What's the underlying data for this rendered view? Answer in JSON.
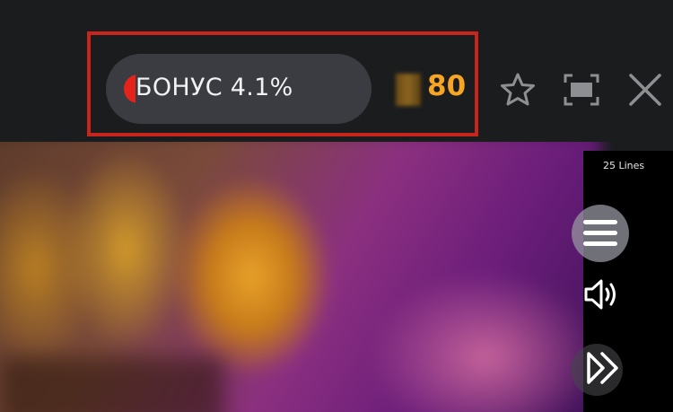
{
  "header": {
    "bonus_label": "БОНУС 4.1%",
    "bonus_progress": 0.041,
    "coins_value": "80",
    "icons": {
      "coin": "coin-icon",
      "star": "star-icon",
      "fullscreen": "fullscreen-icon",
      "close": "close-icon"
    }
  },
  "game": {
    "lines_label": "25 Lines",
    "icons": {
      "menu": "hamburger-menu-icon",
      "sound": "speaker-icon",
      "autoplay": "fast-forward-icon"
    }
  },
  "colors": {
    "background": "#1b1c1e",
    "highlight": "#c8251c",
    "pill": "#3a3c41",
    "progress": "#e4231b",
    "coins": "#f6a623"
  }
}
